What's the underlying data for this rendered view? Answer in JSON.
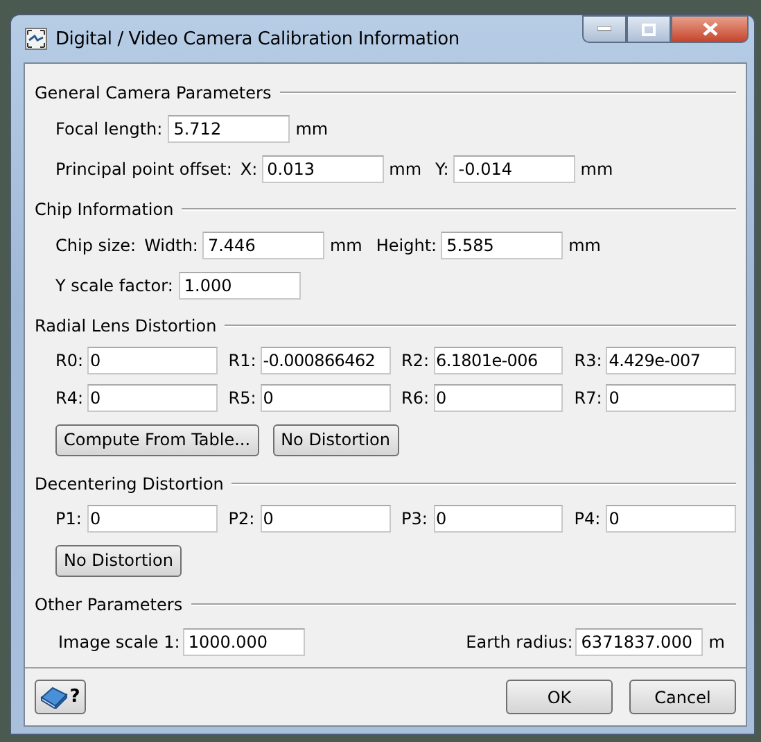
{
  "window": {
    "title": "Digital / Video Camera Calibration Information"
  },
  "sections": [
    {
      "title": "General Camera Parameters",
      "rows": [
        {
          "kind": "fields",
          "caption": "Focal length:",
          "items": [
            {
              "value": "5.712",
              "unit": "mm"
            }
          ]
        },
        {
          "kind": "fields",
          "caption": "Principal point offset:",
          "items": [
            {
              "label": "X:",
              "value": "0.013",
              "unit": "mm"
            },
            {
              "label": "Y:",
              "value": "-0.014",
              "unit": "mm"
            }
          ]
        }
      ]
    },
    {
      "title": "Chip Information",
      "rows": [
        {
          "kind": "fields",
          "caption": "Chip size:",
          "items": [
            {
              "label": "Width:",
              "value": "7.446",
              "unit": "mm"
            },
            {
              "label": "Height:",
              "value": "5.585",
              "unit": "mm"
            }
          ]
        },
        {
          "kind": "fields",
          "caption": "Y scale factor:",
          "items": [
            {
              "value": "1.000"
            }
          ]
        }
      ]
    },
    {
      "title": "Radial Lens Distortion",
      "rows": [
        {
          "kind": "grid",
          "items": [
            {
              "label": "R0:",
              "value": "0"
            },
            {
              "label": "R1:",
              "value": "-0.000866462"
            },
            {
              "label": "R2:",
              "value": "6.1801e-006"
            },
            {
              "label": "R3:",
              "value": "4.429e-007"
            }
          ]
        },
        {
          "kind": "grid",
          "items": [
            {
              "label": "R4:",
              "value": "0"
            },
            {
              "label": "R5:",
              "value": "0"
            },
            {
              "label": "R6:",
              "value": "0"
            },
            {
              "label": "R7:",
              "value": "0"
            }
          ]
        },
        {
          "kind": "buttons",
          "items": [
            {
              "label": "Compute From Table..."
            },
            {
              "label": "No Distortion"
            }
          ]
        }
      ]
    },
    {
      "title": "Decentering Distortion",
      "rows": [
        {
          "kind": "grid",
          "items": [
            {
              "label": "P1:",
              "value": "0"
            },
            {
              "label": "P2:",
              "value": "0"
            },
            {
              "label": "P3:",
              "value": "0"
            },
            {
              "label": "P4:",
              "value": "0"
            }
          ]
        },
        {
          "kind": "buttons",
          "items": [
            {
              "label": "No Distortion"
            }
          ]
        }
      ]
    },
    {
      "title": "Other Parameters",
      "rows": [
        {
          "kind": "split",
          "items": [
            {
              "label": "Image scale  1:",
              "value": "1000.000"
            },
            {
              "label": "Earth radius:",
              "value": "6371837.000",
              "unit": "m"
            }
          ]
        }
      ]
    }
  ],
  "help_button": {
    "label": "?"
  },
  "buttons": [
    "OK",
    "Cancel"
  ]
}
